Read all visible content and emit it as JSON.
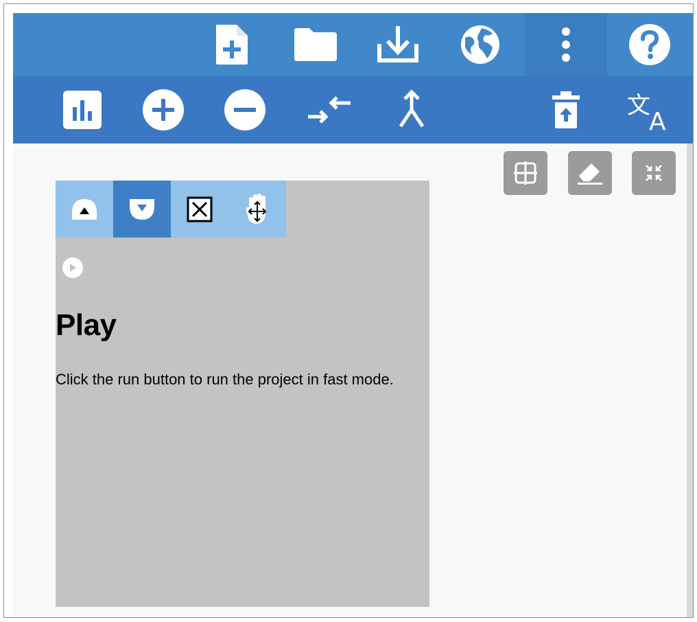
{
  "colors": {
    "toolbar_top": "#4188cb",
    "toolbar_bottom": "#3a78c4",
    "canvas": "#f7f8f8",
    "panel": "#c3c3c3",
    "panel_tool": "#92c1ea",
    "panel_tool_active": "#3e7fc6",
    "float_button": "#9b9b9b"
  },
  "toolbar_top": {
    "buttons": [
      "new-file-icon",
      "folder-icon",
      "download-icon",
      "globe-icon",
      "more-vert-icon",
      "help-icon"
    ]
  },
  "toolbar_bottom": {
    "buttons": [
      "bar-chart-icon",
      "zoom-in-icon",
      "zoom-out-icon",
      "merge-arrows-icon",
      "split-arrow-icon",
      "trash-upload-icon",
      "translate-icon"
    ],
    "translate_glyph": "文A"
  },
  "canvas_controls": [
    "grid-icon",
    "eraser-icon",
    "collapse-icon"
  ],
  "help_panel": {
    "tools": [
      "move-up-icon",
      "move-down-icon",
      "close-box-icon",
      "drag-hand-icon"
    ],
    "active_tool_index": 1,
    "close_glyph": "☒",
    "title": "Play",
    "text": "Click the run button to run the project in fast mode."
  }
}
